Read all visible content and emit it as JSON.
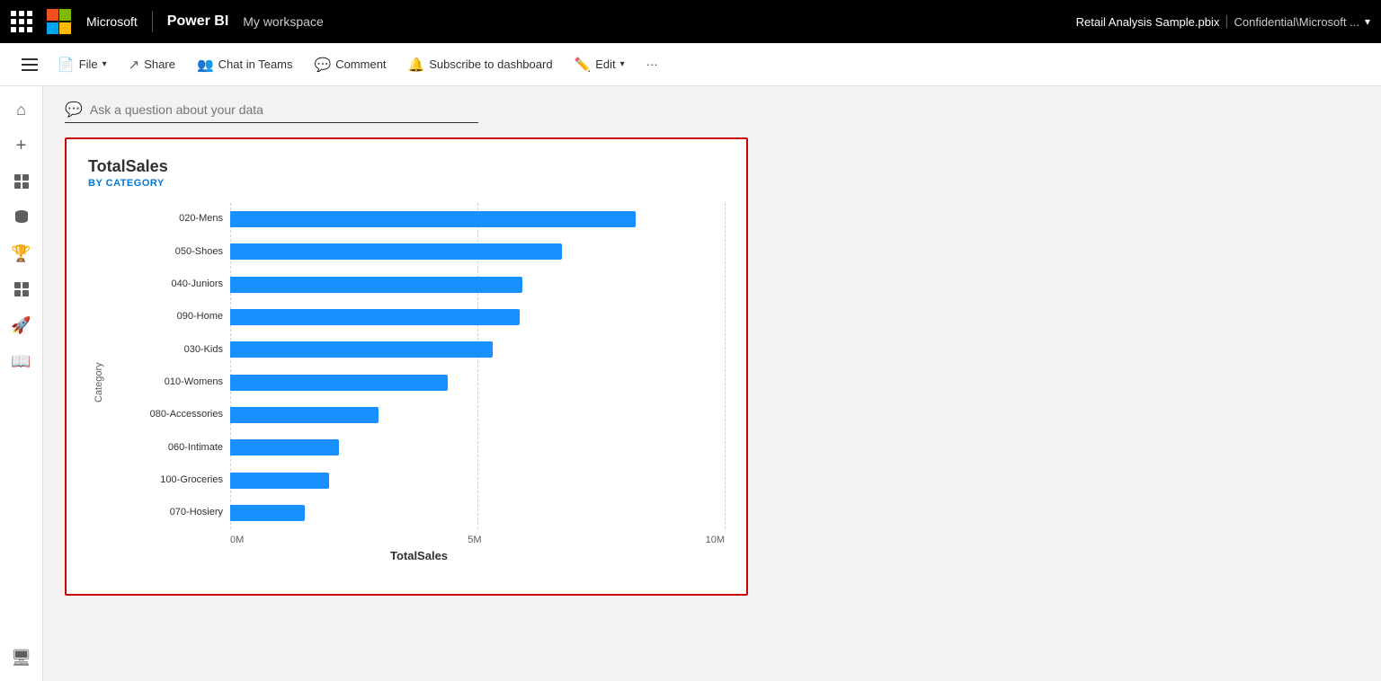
{
  "topbar": {
    "brand": "Microsoft",
    "product": "Power BI",
    "workspace": "My workspace",
    "filename": "Retail Analysis Sample.pbix",
    "confidential": "Confidential\\Microsoft ...",
    "chevron": "▾"
  },
  "toolbar": {
    "hamburger_label": "Menu",
    "file_label": "File",
    "share_label": "Share",
    "chat_label": "Chat in Teams",
    "comment_label": "Comment",
    "subscribe_label": "Subscribe to dashboard",
    "edit_label": "Edit",
    "more_label": "···"
  },
  "sidebar": {
    "items": [
      {
        "name": "home",
        "icon": "⌂",
        "label": "Home"
      },
      {
        "name": "create",
        "icon": "+",
        "label": "Create"
      },
      {
        "name": "browse",
        "icon": "📁",
        "label": "Browse"
      },
      {
        "name": "data",
        "icon": "🗄",
        "label": "Data hub"
      },
      {
        "name": "goals",
        "icon": "🏆",
        "label": "Goals"
      },
      {
        "name": "apps",
        "icon": "⊞",
        "label": "Apps"
      },
      {
        "name": "learn",
        "icon": "🚀",
        "label": "Learn"
      },
      {
        "name": "metrics",
        "icon": "📖",
        "label": "Metrics"
      },
      {
        "name": "workspaces",
        "icon": "🖥",
        "label": "Workspaces"
      }
    ]
  },
  "main": {
    "search_placeholder": "Ask a question about your data",
    "chart": {
      "title": "TotalSales",
      "subtitle": "BY CATEGORY",
      "y_axis_label": "Category",
      "x_axis_label": "TotalSales",
      "x_axis_ticks": [
        "0M",
        "5M",
        "10M"
      ],
      "max_value": 10000000,
      "categories": [
        {
          "name": "020-Mens",
          "value": 8200000
        },
        {
          "name": "050-Shoes",
          "value": 6700000
        },
        {
          "name": "040-Juniors",
          "value": 5900000
        },
        {
          "name": "090-Home",
          "value": 5850000
        },
        {
          "name": "030-Kids",
          "value": 5300000
        },
        {
          "name": "010-Womens",
          "value": 4400000
        },
        {
          "name": "080-Accessories",
          "value": 3000000
        },
        {
          "name": "060-Intimate",
          "value": 2200000
        },
        {
          "name": "100-Groceries",
          "value": 2000000
        },
        {
          "name": "070-Hosiery",
          "value": 1500000
        }
      ],
      "bar_color": "#1890ff"
    }
  }
}
